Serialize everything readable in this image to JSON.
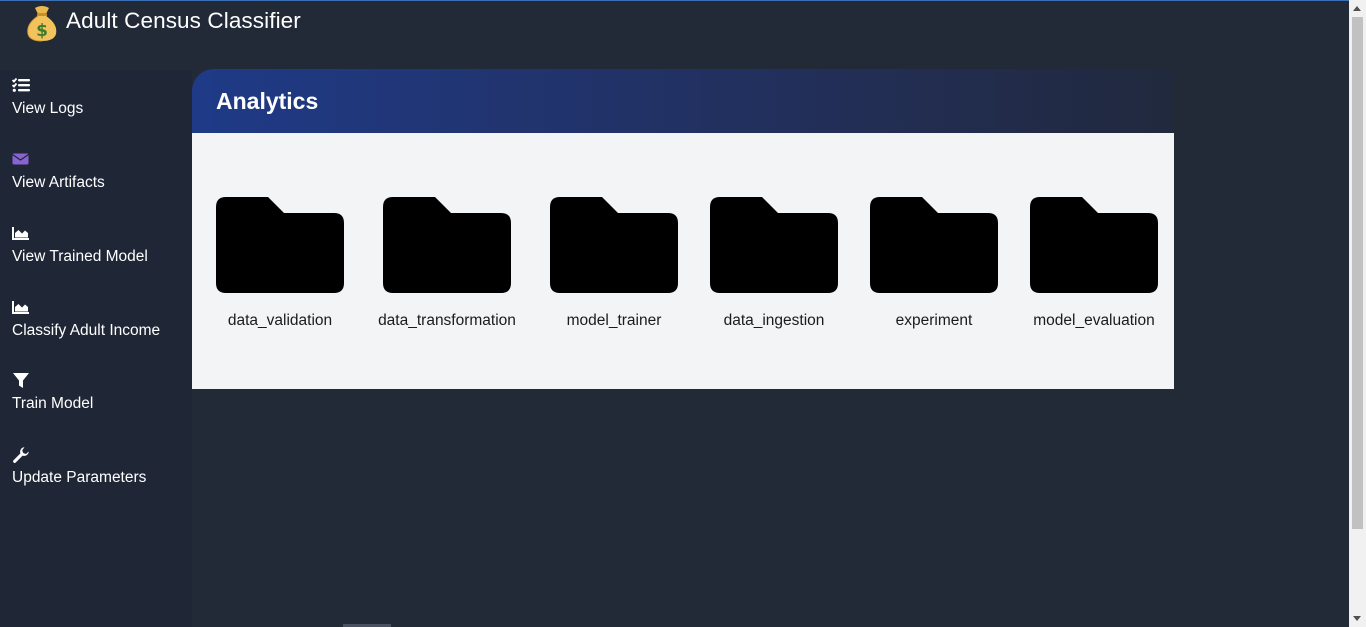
{
  "app": {
    "title": "Adult Census Classifier",
    "logo_icon": "money-bag-icon"
  },
  "sidebar": {
    "items": [
      {
        "label": "View Logs",
        "icon": "list-check-icon"
      },
      {
        "label": "View Artifacts",
        "icon": "envelope-icon"
      },
      {
        "label": "View Trained Model",
        "icon": "area-chart-icon"
      },
      {
        "label": "Classify Adult Income",
        "icon": "area-chart-icon"
      },
      {
        "label": "Train Model",
        "icon": "filter-icon"
      },
      {
        "label": "Update Parameters",
        "icon": "wrench-icon"
      }
    ]
  },
  "main": {
    "title": "Analytics",
    "folders": [
      {
        "label": "data_validation",
        "icon": "folder-icon"
      },
      {
        "label": "data_transformation",
        "icon": "folder-icon"
      },
      {
        "label": "model_trainer",
        "icon": "folder-icon"
      },
      {
        "label": "data_ingestion",
        "icon": "folder-icon"
      },
      {
        "label": "experiment",
        "icon": "folder-icon"
      },
      {
        "label": "model_evaluation",
        "icon": "folder-icon"
      }
    ]
  },
  "colors": {
    "background": "#222a38",
    "sidebar": "#1f2636",
    "header_gradient_start": "#1f3a87",
    "panel_body": "#f3f4f6",
    "accent_purple": "#8a63d2"
  }
}
